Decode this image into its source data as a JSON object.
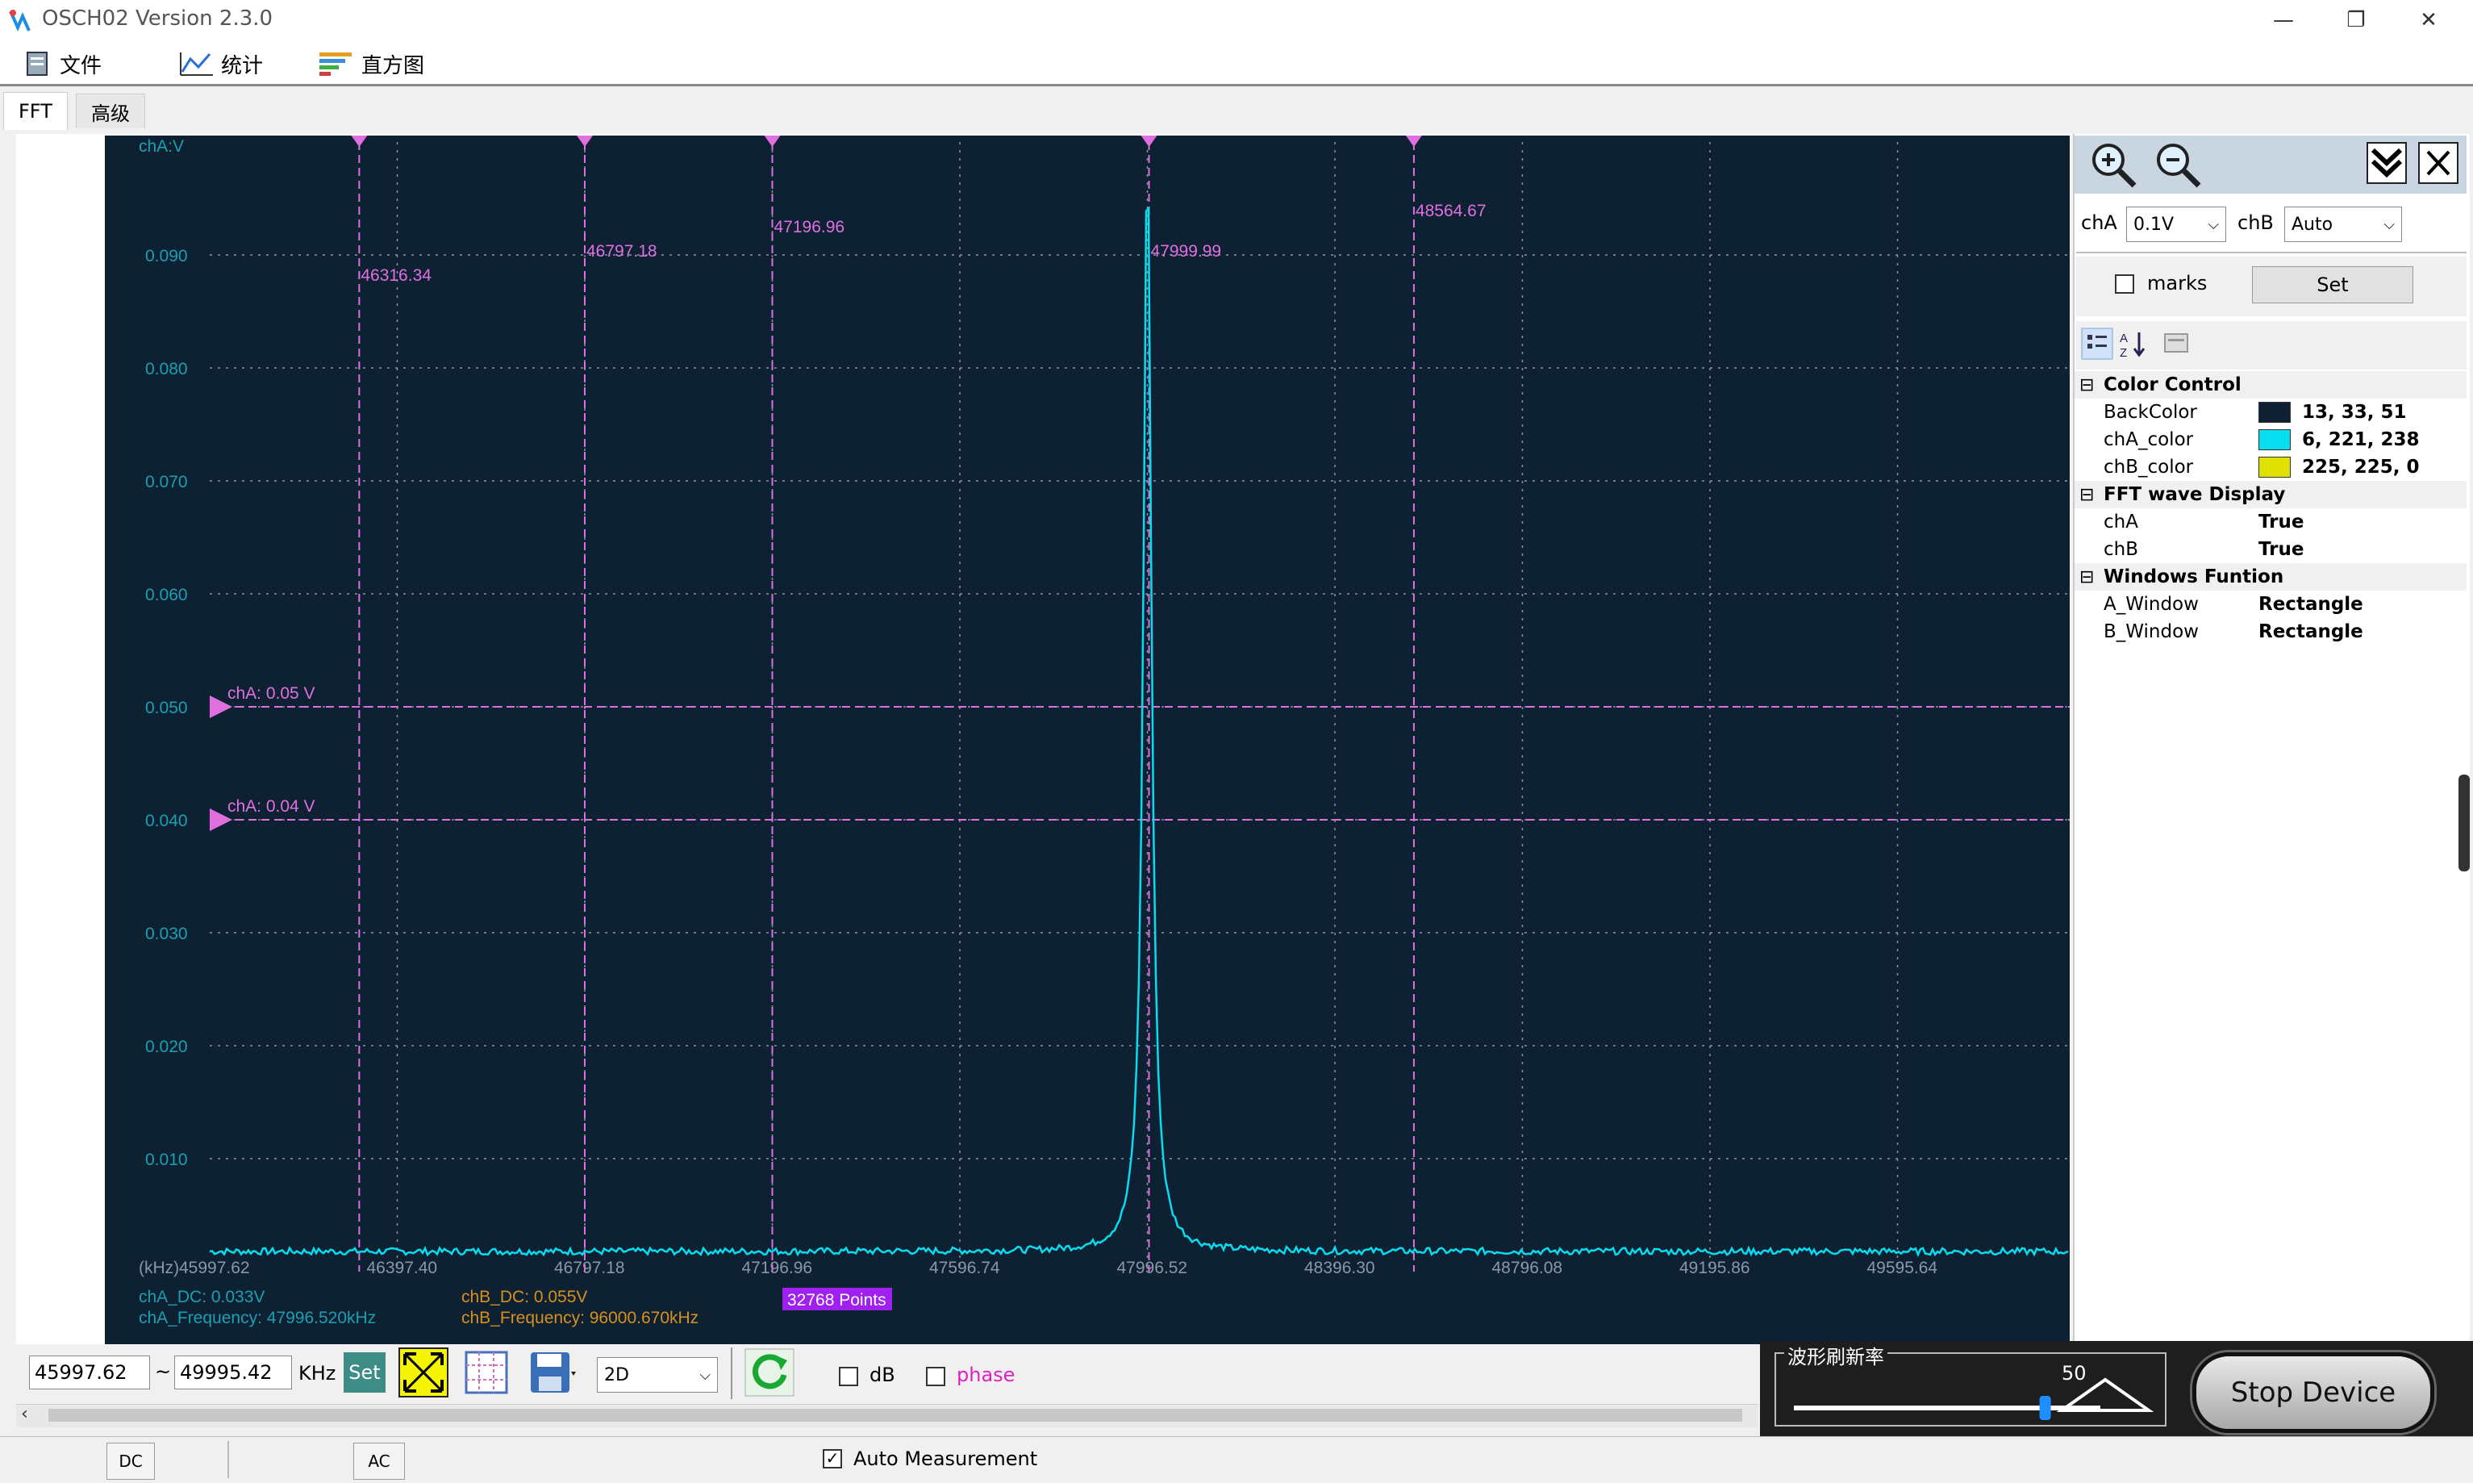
{
  "window": {
    "title": "OSCH02  Version 2.3.0",
    "minimize": "—",
    "restore": "❐",
    "close": "✕"
  },
  "menu": [
    {
      "label": "文件",
      "icon": "file-icon"
    },
    {
      "label": "统计",
      "icon": "chart-icon"
    },
    {
      "label": "直方图",
      "icon": "histogram-icon"
    }
  ],
  "tabs": [
    "FFT",
    "高级"
  ],
  "plot": {
    "y_axis_unit": "chA:V",
    "x_axis_unit": "(kHz)",
    "y_ticks": [
      "0.090",
      "0.080",
      "0.070",
      "0.060",
      "0.050",
      "0.040",
      "0.030",
      "0.020",
      "0.010"
    ],
    "x_ticks": [
      "45997.62",
      "46397.40",
      "46797.18",
      "47196.96",
      "47596.74",
      "47996.52",
      "48396.30",
      "48796.08",
      "49195.86",
      "49595.64"
    ],
    "markers": [
      "46316.34",
      "46797.18",
      "47196.96",
      "47999.99",
      "48564.67"
    ],
    "level_markers": [
      "chA: 0.05 V",
      "chA: 0.04 V"
    ],
    "cha_dc": "chA_DC: 0.033V",
    "cha_freq": "chA_Frequency: 47996.520kHz",
    "chb_dc": "chB_DC: 0.055V",
    "chb_freq": "chB_Frequency: 96000.670kHz",
    "points": "32768 Points",
    "background_color": "#0d2133",
    "trace_color": "#06ddee",
    "marker_color": "#e070e0"
  },
  "right_panel": {
    "cha_label": "chA",
    "cha_value": "0.1V",
    "chb_label": "chB",
    "chb_value": "Auto",
    "marks_label": "marks",
    "set_label": "Set",
    "categories": [
      {
        "name": "Color Control",
        "rows": [
          {
            "name": "BackColor",
            "value": "13, 33, 51",
            "swatch": "#0d2133"
          },
          {
            "name": "chA_color",
            "value": "6, 221, 238",
            "swatch": "#06ddee"
          },
          {
            "name": "chB_color",
            "value": "225, 225, 0",
            "swatch": "#e1e100"
          }
        ]
      },
      {
        "name": "FFT wave Display",
        "rows": [
          {
            "name": "chA",
            "value": "True"
          },
          {
            "name": "chB",
            "value": "True"
          }
        ]
      },
      {
        "name": "Windows Funtion",
        "rows": [
          {
            "name": "A_Window",
            "value": "Rectangle"
          },
          {
            "name": "B_Window",
            "value": "Rectangle"
          }
        ]
      }
    ]
  },
  "toolbar": {
    "start_freq": "45997.62",
    "tilde": "~",
    "end_freq": "49995.42",
    "unit": "KHz",
    "set_label": "Set",
    "view_mode": "2D",
    "db_label": "dB",
    "phase_label": "phase"
  },
  "refresh": {
    "label": "波形刷新率",
    "value": "50",
    "fraction": 0.82
  },
  "stop_label": "Stop Device",
  "status": {
    "dc_label": "DC",
    "ac_label": "AC",
    "auto_label": "Auto Measurement"
  }
}
